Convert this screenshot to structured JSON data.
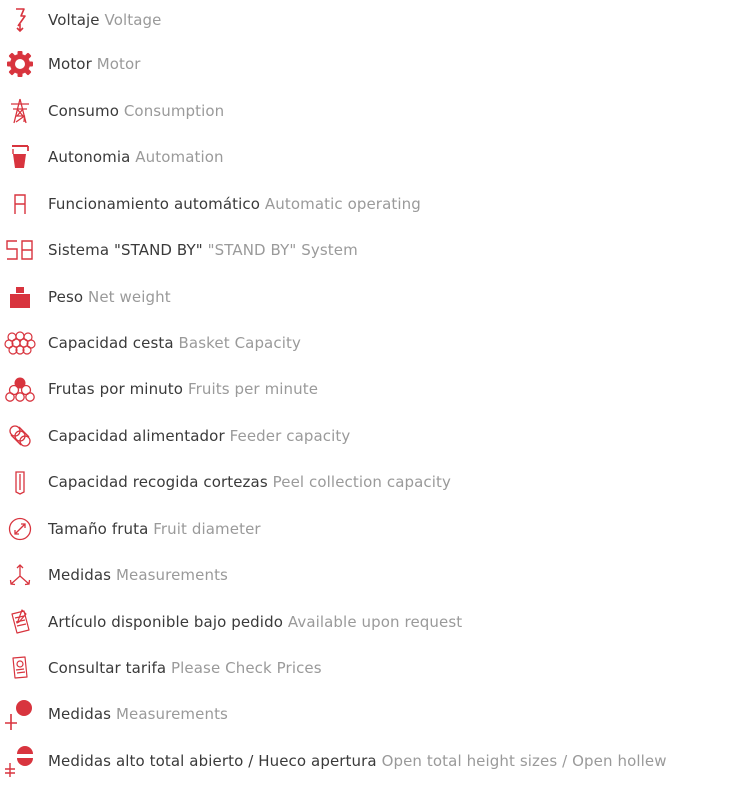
{
  "accent_color": "#d8343e",
  "items": [
    {
      "icon": "voltage-icon",
      "es": "Voltaje",
      "en": "Voltage"
    },
    {
      "icon": "motor-gear-icon",
      "es": "Motor",
      "en": "Motor"
    },
    {
      "icon": "power-tower-icon",
      "es": "Consumo",
      "en": "Consumption"
    },
    {
      "icon": "glass-icon",
      "es": "Autonomia",
      "en": "Automation"
    },
    {
      "icon": "automatic-a-icon",
      "es": "Funcionamiento automático",
      "en": "Automatic operating"
    },
    {
      "icon": "standby-sb-icon",
      "es": "Sistema \"STAND BY\"",
      "en": "\"STAND BY\" System"
    },
    {
      "icon": "weight-icon",
      "es": "Peso",
      "en": "Net weight"
    },
    {
      "icon": "basket-icon",
      "es": "Capacidad cesta",
      "en": "Basket Capacity"
    },
    {
      "icon": "fruits-icon",
      "es": "Frutas por minuto",
      "en": "Fruits per minute"
    },
    {
      "icon": "feeder-icon",
      "es": "Capacidad alimentador",
      "en": "Feeder capacity"
    },
    {
      "icon": "peel-container-icon",
      "es": "Capacidad recogida cortezas",
      "en": "Peel collection capacity"
    },
    {
      "icon": "diameter-icon",
      "es": "Tamaño fruta",
      "en": "Fruit diameter"
    },
    {
      "icon": "measurements-axes-icon",
      "es": "Medidas",
      "en": "Measurements"
    },
    {
      "icon": "order-document-icon",
      "es": "Artículo disponible bajo pedido",
      "en": "Available upon request"
    },
    {
      "icon": "price-list-icon",
      "es": "Consultar tarifa",
      "en": "Please Check Prices"
    },
    {
      "icon": "measurements-circle-icon",
      "es": "Medidas",
      "en": "Measurements"
    },
    {
      "icon": "open-height-icon",
      "es": "Medidas alto total abierto / Hueco apertura",
      "en": "Open total height sizes / Open hollew"
    }
  ]
}
